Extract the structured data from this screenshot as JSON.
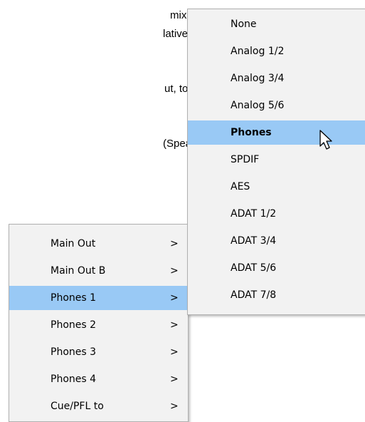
{
  "document": {
    "lines": [
      "mix bus to the ste-",
      "lative volume of the",
      "ut, to hear the mix",
      "(Speaker B), and up"
    ]
  },
  "output_menu": {
    "items": [
      {
        "label": "Main Out",
        "arrow": ">"
      },
      {
        "label": "Main Out B",
        "arrow": ">"
      },
      {
        "label": "Phones 1",
        "arrow": ">"
      },
      {
        "label": "Phones 2",
        "arrow": ">"
      },
      {
        "label": "Phones 3",
        "arrow": ">"
      },
      {
        "label": "Phones 4",
        "arrow": ">"
      },
      {
        "label": "Cue/PFL to",
        "arrow": ">"
      }
    ],
    "highlighted": "Phones 1"
  },
  "routing_submenu": {
    "items": [
      "None",
      "Analog 1/2",
      "Analog 3/4",
      "Analog 5/6",
      "Phones",
      "SPDIF",
      "AES",
      "ADAT 1/2",
      "ADAT 3/4",
      "ADAT 5/6",
      "ADAT 7/8"
    ],
    "selected": "Phones"
  },
  "colors": {
    "highlight": "#99c9f5",
    "menu_background": "#f2f2f2",
    "menu_border": "#b0b0b0"
  },
  "icons": {
    "cursor": "mouse-pointer-icon"
  }
}
